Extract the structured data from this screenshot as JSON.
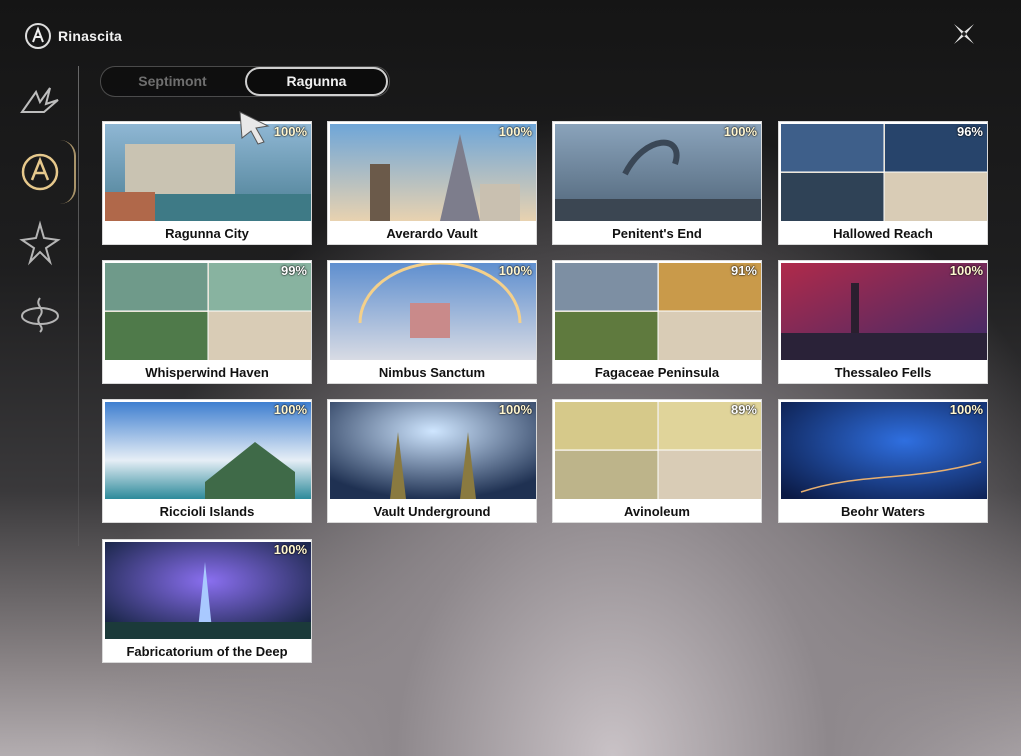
{
  "app": {
    "title": "Rinascita"
  },
  "tabs": [
    {
      "label": "Septimont",
      "active": false
    },
    {
      "label": "Ragunna",
      "active": true
    }
  ],
  "sidebar": {
    "icons": [
      "emblem-wing-icon",
      "emblem-crest-icon",
      "emblem-star-icon",
      "emblem-knot-icon"
    ],
    "active_index": 1
  },
  "regions": [
    {
      "name": "Ragunna City",
      "completion": "100%"
    },
    {
      "name": "Averardo Vault",
      "completion": "100%"
    },
    {
      "name": "Penitent's End",
      "completion": "100%"
    },
    {
      "name": "Hallowed Reach",
      "completion": "96%"
    },
    {
      "name": "Whisperwind Haven",
      "completion": "99%"
    },
    {
      "name": "Nimbus Sanctum",
      "completion": "100%"
    },
    {
      "name": "Fagaceae Peninsula",
      "completion": "91%"
    },
    {
      "name": "Thessaleo Fells",
      "completion": "100%"
    },
    {
      "name": "Riccioli Islands",
      "completion": "100%"
    },
    {
      "name": "Vault Underground",
      "completion": "100%"
    },
    {
      "name": "Avinoleum",
      "completion": "89%"
    },
    {
      "name": "Beohr Waters",
      "completion": "100%"
    },
    {
      "name": "Fabricatorium of the Deep",
      "completion": "100%"
    }
  ],
  "colors": {
    "card_bg": "#ffffff",
    "label_text": "#111111",
    "accent": "#e6c88c"
  }
}
